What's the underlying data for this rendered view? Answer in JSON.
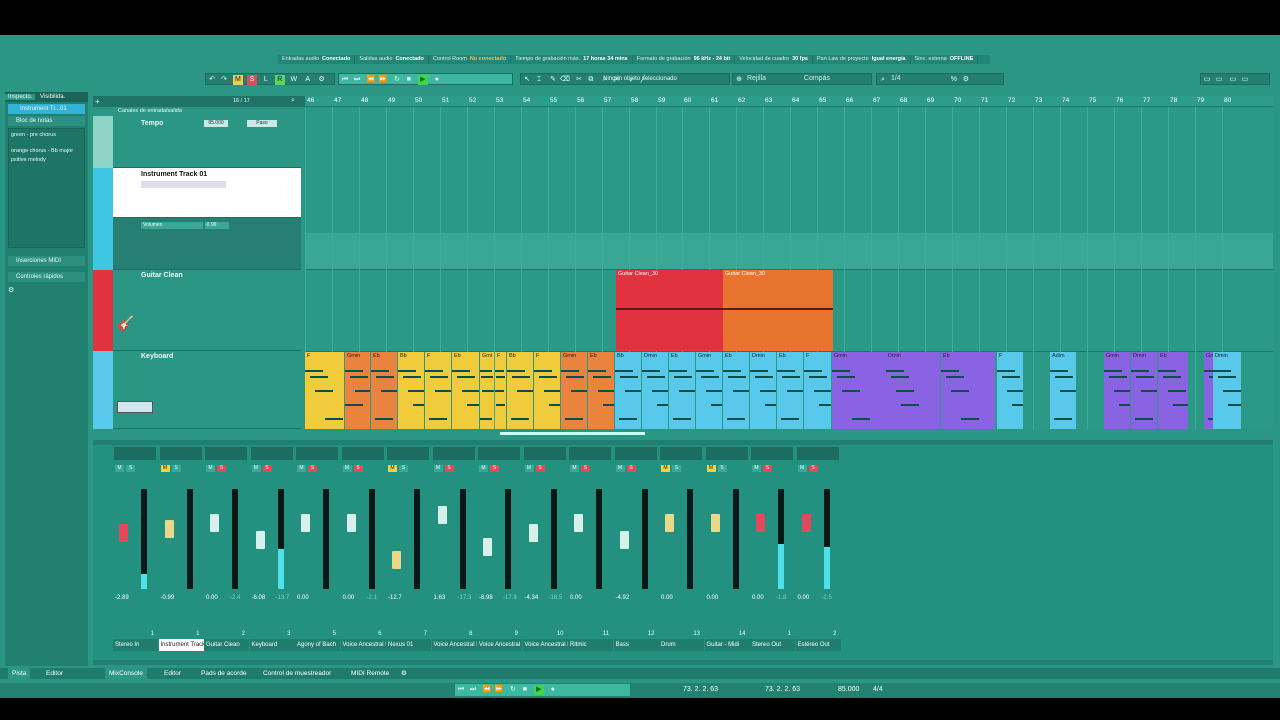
{
  "toolbar": {
    "msrwa": [
      "M",
      "S",
      "L",
      "R",
      "W",
      "A"
    ],
    "snap_mode": "Rejilla",
    "grid_type": "Compás",
    "quantize": "1/4"
  },
  "infobar": {
    "items": [
      {
        "label": "Entradas audio",
        "value": "Conectado"
      },
      {
        "label": "Salidas audio",
        "value": "Conectado"
      },
      {
        "label": "Control Room",
        "value": "No conectado"
      },
      {
        "label": "Tiempo de grabación máx.",
        "value": "17 horas 34 mins"
      },
      {
        "label": "Formato de grabación",
        "value": "96 kHz - 24 bit"
      },
      {
        "label": "Velocidad de cuadro",
        "value": "30 fps"
      },
      {
        "label": "Pan Law de proyecto",
        "value": "Igual energía"
      },
      {
        "label": "Sinc. externa",
        "value": "OFFLINE"
      }
    ],
    "status": "Ningún objeto seleccionado"
  },
  "inspector": {
    "tabs": [
      "Inspecto.",
      "Visibilida."
    ],
    "track_name": "Instrument Tr...01",
    "notepad_title": "Bloc de notas",
    "notes": [
      "green - pre chorus",
      "",
      "orange chorus - Bb major",
      "psitive melody"
    ],
    "sections": [
      "Inserciones MIDI",
      "Controles rápidos"
    ]
  },
  "tracklist": {
    "header": "Canales de entrada/salida",
    "counter": "16 / 17",
    "tempo": {
      "name": "Tempo",
      "value": "85.000",
      "mode": "Paso"
    },
    "instrument": {
      "name": "Instrument Track 01",
      "volume_label": "Volumen",
      "volume": "-0.99"
    },
    "guitar": {
      "name": "Guitar Clean"
    },
    "keyboard": {
      "name": "Keyboard"
    }
  },
  "ruler": {
    "bars": [
      "46",
      "47",
      "48",
      "49",
      "50",
      "51",
      "52",
      "53",
      "54",
      "55",
      "56",
      "57",
      "58",
      "59",
      "60",
      "61",
      "62",
      "63",
      "64",
      "65",
      "66",
      "67",
      "68",
      "69",
      "70",
      "71",
      "72",
      "73",
      "74",
      "75",
      "76",
      "77",
      "78",
      "79",
      "80"
    ]
  },
  "clips": {
    "guitar": [
      {
        "label": "Guitar Clean_30",
        "color": "#e0323f"
      },
      {
        "label": "Guitar Clean_30",
        "color": "#e9742f"
      }
    ],
    "keyboard": [
      {
        "label": "F",
        "color": "#f0cb3b"
      },
      {
        "label": "Gmin",
        "color": "#e9833d"
      },
      {
        "label": "Eb",
        "color": "#e9833d"
      },
      {
        "label": "Bb",
        "color": "#f0cb3b"
      },
      {
        "label": "F",
        "color": "#f0cb3b"
      },
      {
        "label": "Eb",
        "color": "#f0cb3b"
      },
      {
        "label": "Gmi",
        "color": "#f0cb3b"
      },
      {
        "label": "F",
        "color": "#f0cb3b"
      },
      {
        "label": "Bb",
        "color": "#f0cb3b"
      },
      {
        "label": "F",
        "color": "#f0cb3b"
      },
      {
        "label": "Gmin",
        "color": "#e9833d"
      },
      {
        "label": "Eb",
        "color": "#e9833d"
      },
      {
        "label": "Bb",
        "color": "#58c9ea"
      },
      {
        "label": "Dmin",
        "color": "#58c9ea"
      },
      {
        "label": "Eb",
        "color": "#58c9ea"
      },
      {
        "label": "Gmin",
        "color": "#58c9ea"
      },
      {
        "label": "Eb",
        "color": "#58c9ea"
      },
      {
        "label": "Dmin",
        "color": "#58c9ea"
      },
      {
        "label": "Eb",
        "color": "#58c9ea"
      },
      {
        "label": "F",
        "color": "#58c9ea"
      },
      {
        "label": "Gmin",
        "color": "#8a63e3"
      },
      {
        "label": "Dmin",
        "color": "#8a63e3"
      },
      {
        "label": "Eb",
        "color": "#8a63e3"
      },
      {
        "label": "F",
        "color": "#58c9ea"
      },
      {
        "label": "Adim",
        "color": "#58c9ea"
      },
      {
        "label": "Gmin",
        "color": "#8a63e3"
      },
      {
        "label": "Dmin",
        "color": "#8a63e3"
      },
      {
        "label": "Eb",
        "color": "#8a63e3"
      },
      {
        "label": "Gmin",
        "color": "#8a63e3"
      },
      {
        "label": "Dmin",
        "color": "#58c9ea"
      }
    ]
  },
  "mixer": {
    "channels": [
      {
        "num": "1",
        "name": "Stereo In",
        "value": "-2.89",
        "peak": "",
        "solo": false,
        "mute": false
      },
      {
        "num": "1",
        "name": "Instrument Track 01",
        "value": "-0.99",
        "peak": "",
        "solo": false,
        "mute": true
      },
      {
        "num": "2",
        "name": "Guitar Clean",
        "value": "0.00",
        "peak": "-2.4",
        "solo": true,
        "mute": false
      },
      {
        "num": "3",
        "name": "Keyboard",
        "value": "-6.08",
        "peak": "-13.7",
        "solo": true,
        "mute": false
      },
      {
        "num": "5",
        "name": "Agony of Bach",
        "value": "0.00",
        "peak": "",
        "solo": true,
        "mute": false
      },
      {
        "num": "6",
        "name": "Voice Ancestral Elf",
        "value": "0.00",
        "peak": "-2.1",
        "solo": true,
        "mute": false
      },
      {
        "num": "7",
        "name": "Nexus 01",
        "value": "-12.7",
        "peak": "",
        "solo": false,
        "mute": true
      },
      {
        "num": "8",
        "name": "Voice Ancestral Elf (D)",
        "value": "1.63",
        "peak": "-17.3",
        "solo": true,
        "mute": false
      },
      {
        "num": "9",
        "name": "Voice Ancestral Elf (D)",
        "value": "-8.98",
        "peak": "-17.9",
        "solo": true,
        "mute": false
      },
      {
        "num": "10",
        "name": "Voice Ancestral Elf (D)",
        "value": "-4.34",
        "peak": "-18.5",
        "solo": true,
        "mute": false
      },
      {
        "num": "11",
        "name": "Ritmic",
        "value": "0.00",
        "peak": "",
        "solo": true,
        "mute": false
      },
      {
        "num": "12",
        "name": "Bass",
        "value": "-4.92",
        "peak": "",
        "solo": true,
        "mute": false
      },
      {
        "num": "13",
        "name": "Drum",
        "value": "0.00",
        "peak": "",
        "solo": false,
        "mute": true
      },
      {
        "num": "14",
        "name": "Guitar - Midi",
        "value": "0.00",
        "peak": "",
        "solo": false,
        "mute": true
      },
      {
        "num": "1",
        "name": "Stereo Out",
        "value": "0.00",
        "peak": "-1.8",
        "solo": true,
        "mute": false
      },
      {
        "num": "2",
        "name": "Estéreo Out",
        "value": "0.00",
        "peak": "-2.5",
        "solo": true,
        "mute": false
      }
    ],
    "meter_levels": [
      0.15,
      0.0,
      0.0,
      0.4,
      0.0,
      0.0,
      0.0,
      0.0,
      0.0,
      0.0,
      0.0,
      0.0,
      0.0,
      0.0,
      0.45,
      0.42
    ]
  },
  "bottom_tabs": [
    "Pista",
    "Editor",
    "MixConsole",
    "Editor",
    "Pads de acorde",
    "Control de muestreador",
    "MIDI Remote"
  ],
  "transport": {
    "pos1": "73. 2. 2. 63",
    "pos2": "73. 2. 2. 63",
    "tempo": "85.000",
    "signature": "4/4"
  }
}
